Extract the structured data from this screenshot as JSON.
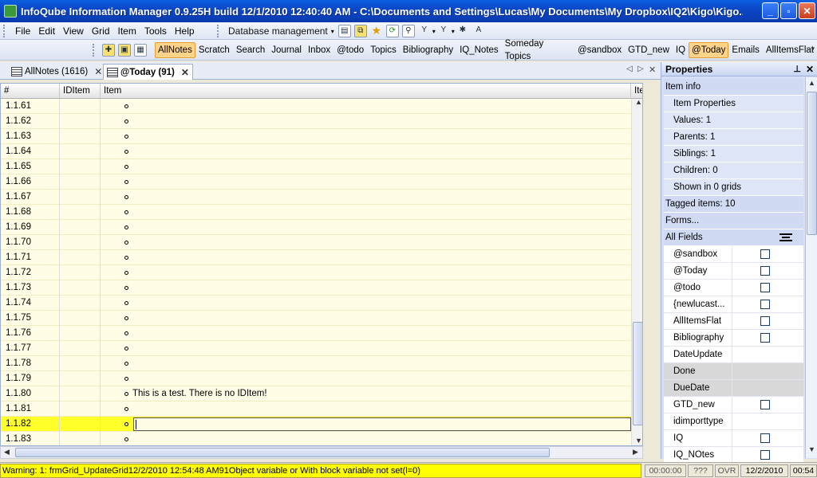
{
  "window": {
    "title": "InfoQube Information Manager 0.9.25H  build 12/1/2010 12:40:40 AM - C:\\Documents and Settings\\Lucas\\My Documents\\My Dropbox\\IQ2\\Kigo\\Kigo..."
  },
  "menu": [
    "File",
    "Edit",
    "View",
    "Grid",
    "Item",
    "Tools",
    "Help"
  ],
  "toolbar": {
    "db_management": "Database management"
  },
  "quicklinks": [
    "AllNotes",
    "Scratch",
    "Search",
    "Journal",
    "Inbox",
    "@todo",
    "Topics",
    "Bibliography",
    "IQ_Notes",
    "Someday Topics",
    "@sandbox",
    "GTD_new",
    "IQ",
    "@Today",
    "Emails",
    "AllItemsFlat"
  ],
  "quicklinks_active": [
    "AllNotes",
    "@Today"
  ],
  "tabs": [
    {
      "label": "AllNotes (1616)"
    },
    {
      "label": "@Today (91)"
    }
  ],
  "grid": {
    "columns": [
      "#",
      "IDItem",
      "Item",
      "Ite"
    ],
    "rows": [
      {
        "num": "1.1.61",
        "item": ""
      },
      {
        "num": "1.1.62",
        "item": ""
      },
      {
        "num": "1.1.63",
        "item": ""
      },
      {
        "num": "1.1.64",
        "item": ""
      },
      {
        "num": "1.1.65",
        "item": ""
      },
      {
        "num": "1.1.66",
        "item": ""
      },
      {
        "num": "1.1.67",
        "item": ""
      },
      {
        "num": "1.1.68",
        "item": ""
      },
      {
        "num": "1.1.69",
        "item": ""
      },
      {
        "num": "1.1.70",
        "item": ""
      },
      {
        "num": "1.1.71",
        "item": ""
      },
      {
        "num": "1.1.72",
        "item": ""
      },
      {
        "num": "1.1.73",
        "item": ""
      },
      {
        "num": "1.1.74",
        "item": ""
      },
      {
        "num": "1.1.75",
        "item": ""
      },
      {
        "num": "1.1.76",
        "item": ""
      },
      {
        "num": "1.1.77",
        "item": ""
      },
      {
        "num": "1.1.78",
        "item": ""
      },
      {
        "num": "1.1.79",
        "item": ""
      },
      {
        "num": "1.1.80",
        "item": "This is a test. There is no IDItem!"
      },
      {
        "num": "1.1.81",
        "item": ""
      },
      {
        "num": "1.1.82",
        "item": "",
        "selected": true
      },
      {
        "num": "1.1.83",
        "item": ""
      }
    ]
  },
  "properties": {
    "title": "Properties",
    "item_info": "Item info",
    "item_properties": "Item Properties",
    "values": "Values: 1",
    "parents": "Parents: 1",
    "siblings": "Siblings: 1",
    "children": "Children: 0",
    "shown_in": "Shown in 0 grids",
    "tagged_items": "Tagged items: 10",
    "forms": "Forms...",
    "all_fields": "All Fields",
    "fields": [
      {
        "name": "@sandbox",
        "checkbox": true
      },
      {
        "name": "@Today",
        "checkbox": true
      },
      {
        "name": "@todo",
        "checkbox": true
      },
      {
        "name": "{newlucast...",
        "checkbox": true
      },
      {
        "name": "AllItemsFlat",
        "checkbox": true
      },
      {
        "name": "Bibliography",
        "checkbox": true
      },
      {
        "name": "DateUpdate",
        "checkbox": false
      },
      {
        "name": "Done",
        "checkbox": false,
        "gray": true
      },
      {
        "name": "DueDate",
        "checkbox": false,
        "gray": true
      },
      {
        "name": "GTD_new",
        "checkbox": true
      },
      {
        "name": "idimporttype",
        "checkbox": false
      },
      {
        "name": "IQ",
        "checkbox": true
      },
      {
        "name": "IQ_NOtes",
        "checkbox": true
      }
    ]
  },
  "status": {
    "warning": "Warning: 1: frmGrid_UpdateGrid12/2/2010 12:54:48 AM91Object variable or With block variable not set(l=0)",
    "timer": "00:00:00",
    "unknown": "???",
    "ovr": "OVR",
    "date": "12/2/2010",
    "time": "00:54"
  },
  "colors": {
    "selected_row": "#ffff29",
    "row_bg": "#fffde5",
    "warning_bg": "#ffff00",
    "active_link": "#ffd48a"
  }
}
